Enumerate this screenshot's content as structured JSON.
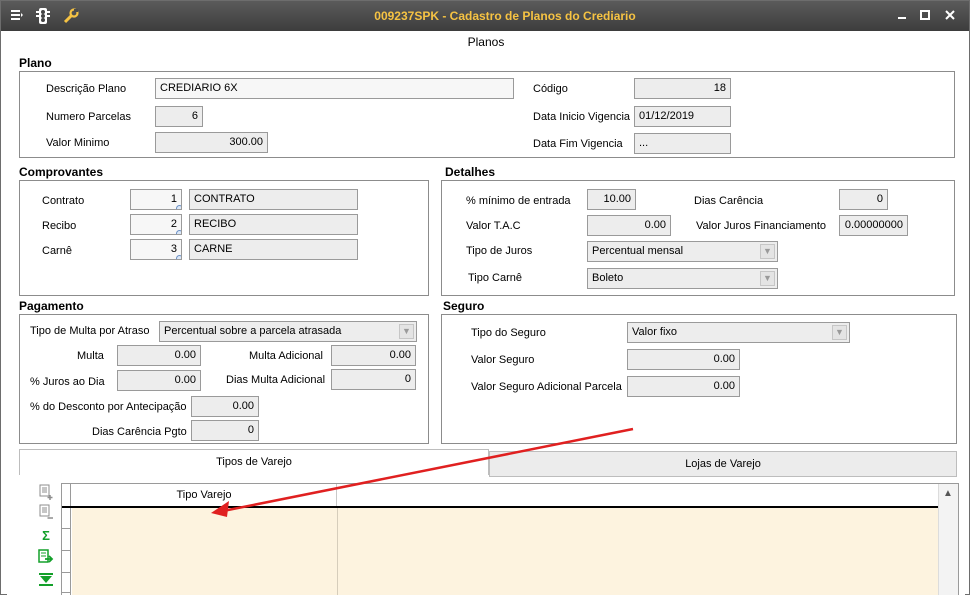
{
  "titlebar": {
    "title": "009237SPK - Cadastro de Planos do Crediario",
    "icons": [
      "menu-icon",
      "traffic-light-icon",
      "wrench-icon"
    ],
    "controls": [
      "minimize-icon",
      "maximize-icon",
      "close-icon"
    ]
  },
  "page_caption": "Planos",
  "plano": {
    "title": "Plano",
    "descricao_label": "Descrição Plano",
    "descricao_value": "CREDIARIO 6X",
    "parcelas_label": "Numero Parcelas",
    "parcelas_value": "6",
    "valor_minimo_label": "Valor Minimo",
    "valor_minimo_value": "300.00",
    "codigo_label": "Código",
    "codigo_value": "18",
    "inicio_label": "Data Inicio Vigencia",
    "inicio_value": "01/12/2019",
    "fim_label": "Data Fim Vigencia",
    "fim_value": "..."
  },
  "comprovantes": {
    "title": "Comprovantes",
    "rows": [
      {
        "label": "Contrato",
        "code": "1",
        "name": "CONTRATO"
      },
      {
        "label": "Recibo",
        "code": "2",
        "name": "RECIBO"
      },
      {
        "label": "Carnê",
        "code": "3",
        "name": "CARNE"
      }
    ]
  },
  "detalhes": {
    "title": "Detalhes",
    "min_entrada_label": "% mínimo de entrada",
    "min_entrada_value": "10.00",
    "dias_carencia_label": "Dias Carência",
    "dias_carencia_value": "0",
    "tac_label": "Valor T.A.C",
    "tac_value": "0.00",
    "juros_fin_label": "Valor Juros Financiamento",
    "juros_fin_value": "0.00000000",
    "tipo_juros_label": "Tipo de Juros",
    "tipo_juros_value": "Percentual mensal",
    "tipo_carne_label": "Tipo Carnê",
    "tipo_carne_value": "Boleto"
  },
  "pagamento": {
    "title": "Pagamento",
    "tipo_multa_label": "Tipo de Multa por Atraso",
    "tipo_multa_value": "Percentual sobre a parcela atrasada",
    "multa_label": "Multa",
    "multa_value": "0.00",
    "multa_adicional_label": "Multa Adicional",
    "multa_adicional_value": "0.00",
    "juros_dia_label": "% Juros ao Dia",
    "juros_dia_value": "0.00",
    "dias_multa_adicional_label": "Dias Multa Adicional",
    "dias_multa_adicional_value": "0",
    "desconto_label": "% do Desconto por Antecipação",
    "desconto_value": "0.00",
    "dias_carencia_pgto_label": "Dias Carência Pgto",
    "dias_carencia_pgto_value": "0"
  },
  "seguro": {
    "title": "Seguro",
    "tipo_label": "Tipo do Seguro",
    "tipo_value": "Valor fixo",
    "valor_label": "Valor Seguro",
    "valor_value": "0.00",
    "adicional_label": "Valor Seguro Adicional Parcela",
    "adicional_value": "0.00"
  },
  "tabs": [
    {
      "label": "Tipos de Varejo",
      "active": true
    },
    {
      "label": "Lojas de Varejo",
      "active": false
    }
  ],
  "grid": {
    "column_header": "Tipo Varejo",
    "side_icons": [
      "add-row-icon",
      "remove-row-icon",
      "sum-icon",
      "export-icon",
      "download-icon"
    ]
  },
  "colors": {
    "titlebar_text": "#f6c343",
    "grid_row_bg": "#fdf3df",
    "annotation_arrow": "#e02020",
    "icon_green": "#13a02a"
  }
}
